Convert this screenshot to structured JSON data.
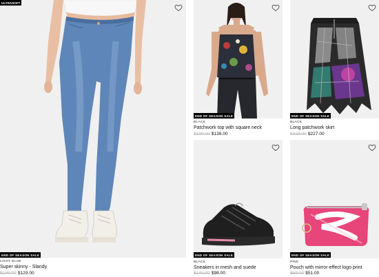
{
  "products": [
    {
      "top_badge": "ULTRASOFT",
      "badge": "END OF SEASON SALE",
      "color": "LIGHT BLUE",
      "name": "Super skinny - Slandy",
      "old_price": "$189.00",
      "new_price": "$129.00",
      "image": "light-blue-skinny-jeans-model-photo"
    },
    {
      "badge": "END OF SEASON SALE",
      "color": "BLACK",
      "name": "Patchwork top with square neck",
      "old_price": "$199.00",
      "new_price": "$136.00",
      "image": "patchwork-top-model-photo"
    },
    {
      "badge": "END OF SEASON SALE",
      "color": "BLACK",
      "name": "Long patchwork skirt",
      "old_price": "$329.00",
      "new_price": "$227.00",
      "image": "patchwork-skirt-photo"
    },
    {
      "badge": "END OF SEASON SALE",
      "color": "BLACK",
      "name": "Sneakers in mesh and suede",
      "old_price": "$140.00",
      "new_price": "$98.00",
      "image": "black-sneaker-photo"
    },
    {
      "badge": "END OF SEASON SALE",
      "color": "PINK",
      "name": "Pouch with mirror-effect logo print",
      "old_price": "$69.00",
      "new_price": "$51.00",
      "image": "pink-logo-pouch-photo"
    }
  ],
  "icons": {
    "favorite": "heart-outline-icon"
  },
  "colors": {
    "card_bg": "#f0f0f0",
    "badge_bg": "#000000",
    "old_price": "#b4b4b4",
    "pouch_pink": "#e8457a"
  }
}
